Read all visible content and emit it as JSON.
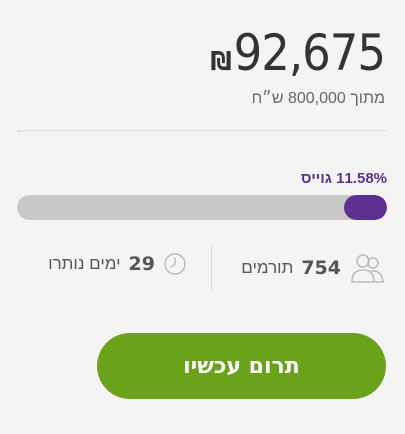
{
  "campaign": {
    "currency_symbol": "₪",
    "amount_raised": "92,675",
    "goal_text": "מתוך 800,000 ש״ח",
    "raised_label": "11.58% גוייס",
    "progress_fraction": 0.1158
  },
  "stats": {
    "donors_count": "754",
    "donors_label": "תורמים",
    "days_count": "29",
    "days_label": "ימים נותרו"
  },
  "cta": {
    "donate_label": "תרום עכשיו"
  },
  "colors": {
    "accent_purple": "#5c3191",
    "button_green": "#6aa21b",
    "track_gray": "#c9c9c9"
  },
  "icons": {
    "donors": "users-icon",
    "days": "clock-icon"
  }
}
